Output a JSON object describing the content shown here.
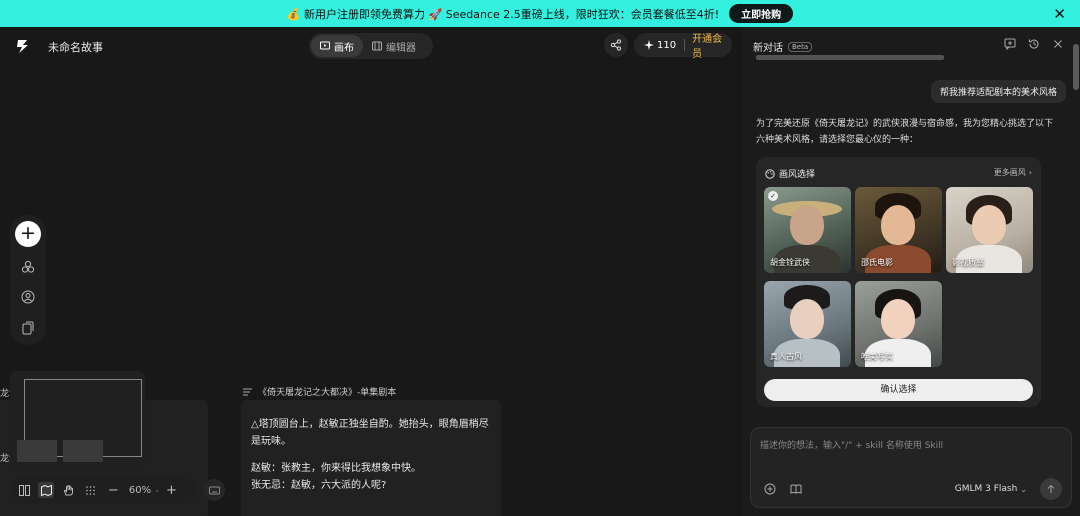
{
  "promo": {
    "text": "💰 新用户注册即领免费算力 🚀 Seedance 2.5重磅上线，限时狂欢：会员套餐低至4折!",
    "cta": "立即抢购"
  },
  "header": {
    "project_title": "未命名故事",
    "tabs": [
      {
        "label": "画布"
      },
      {
        "label": "编辑器"
      }
    ],
    "credits": "110",
    "vip_label": "开通会员"
  },
  "canvas": {
    "left_card_label": "龙记",
    "left_card_label2": "龙记",
    "script_title": "《倚天屠龙记之大都决》-单集剧本",
    "script_lines": [
      "△塔顶圆台上，赵敏正独坐自酌。她抬头，眼角眉梢尽是玩味。",
      "赵敏：张教主，你来得比我想象中快。",
      "张无忌：赵敏，六大派的人呢?"
    ],
    "zoom": "60%"
  },
  "chat": {
    "title": "新对话",
    "beta": "Beta",
    "user_message": "帮我推荐适配剧本的美术风格",
    "assistant_message": "为了完美还原《倚天屠龙记》的武侠浪漫与宿命感，我为您精心挑选了以下六种美术风格，请选择您最心仪的一种：",
    "style_panel": {
      "title": "画风选择",
      "more": "更多画风",
      "styles": [
        {
          "label": "胡金铨武侠",
          "selected": true
        },
        {
          "label": "邵氏电影",
          "selected": false
        },
        {
          "label": "影视质感",
          "selected": false
        },
        {
          "label": "真人古风",
          "selected": false
        },
        {
          "label": "唯美写实",
          "selected": false
        }
      ],
      "confirm": "确认选择"
    },
    "composer": {
      "placeholder": "描述你的想法，输入\"/\" + skill 名称使用 Skill",
      "model": "GMLM 3 Flash"
    }
  },
  "colors": {
    "banner": "#33f0df",
    "vip": "#f0b84b",
    "background": "#181818"
  }
}
